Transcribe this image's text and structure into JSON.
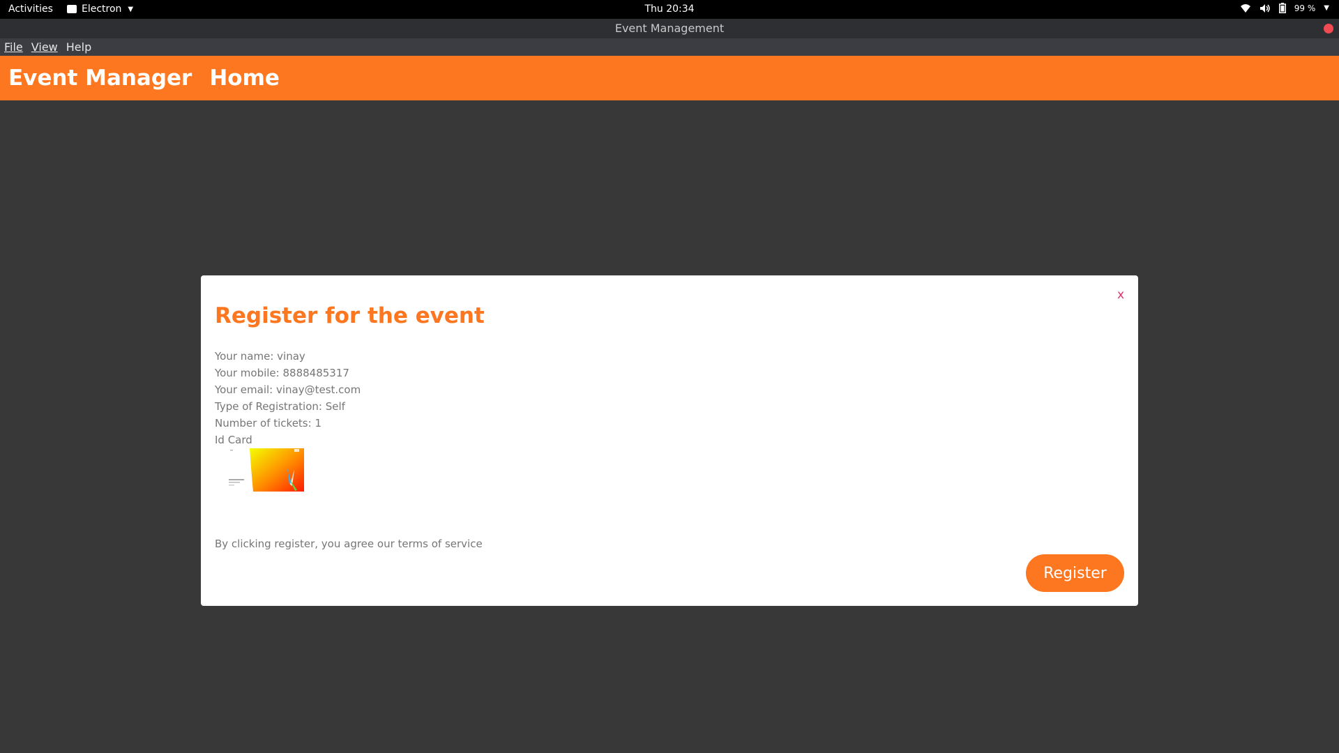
{
  "system_bar": {
    "activities": "Activities",
    "app_name": "Electron",
    "clock": "Thu 20:34",
    "battery": "99 %"
  },
  "window": {
    "title": "Event Management"
  },
  "menu": {
    "items": [
      {
        "label": "File"
      },
      {
        "label": "View"
      },
      {
        "label": "Help"
      }
    ]
  },
  "navbar": {
    "brand": "Event Manager",
    "home": "Home"
  },
  "modal": {
    "title": "Register for the event",
    "close_label": "x",
    "details": [
      "Your name: vinay",
      "Your mobile: 8888485317",
      "Your email: vinay@test.com",
      "Type of Registration: Self",
      "Number of tickets: 1",
      "Id Card"
    ],
    "terms": "By clicking register, you agree our terms of service",
    "register_label": "Register"
  },
  "colors": {
    "accent": "#fc771f",
    "background": "#383838",
    "close": "#d9336b"
  }
}
